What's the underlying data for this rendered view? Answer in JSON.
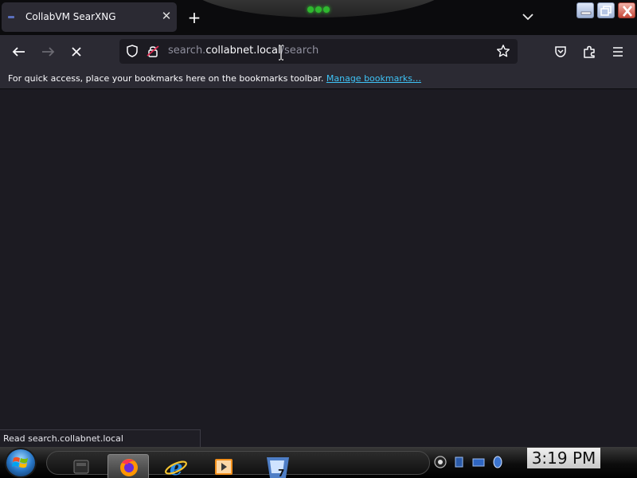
{
  "window": {
    "tab": {
      "title": "CollabVM SearXNG",
      "close_glyph": "✕",
      "favicon": "searxng-favicon"
    },
    "new_tab_glyph": "+",
    "list_tabs_icon": "chevron-down-icon",
    "controls": [
      "minimize-icon",
      "restore-icon",
      "close-icon"
    ]
  },
  "navbar": {
    "back_icon": "arrow-left-icon",
    "forward_icon": "arrow-right-icon",
    "stop_icon": "stop-icon",
    "url": {
      "prefix": "search.",
      "host": "collabnet.local",
      "path": "/search"
    },
    "icons": [
      "shield-icon",
      "insecure-lock-icon",
      "star-icon",
      "pocket-icon",
      "extensions-icon",
      "menu-icon"
    ]
  },
  "bookmarks_bar": {
    "message": "For quick access, place your bookmarks here on the bookmarks toolbar.",
    "link": "Manage bookmarks…"
  },
  "status_bar": {
    "text": "Read search.collabnet.local"
  },
  "taskbar": {
    "start_icon": "windows-orb-icon",
    "apps": [
      "explorer-icon",
      "firefox-icon",
      "internet-explorer-icon",
      "media-player-icon",
      "windows7-icon"
    ],
    "active_app": "firefox-icon",
    "tray_icons": [
      "volume-icon",
      "network-icon",
      "action-center-icon",
      "security-icon"
    ],
    "clock": "3:19 PM"
  },
  "colors": {
    "chrome_dark": "#2b2a33",
    "content_bg": "#1c1b22",
    "tabstrip_bg": "#0b0b0d",
    "link": "#3ec3f6",
    "lock_red": "#e22850"
  }
}
